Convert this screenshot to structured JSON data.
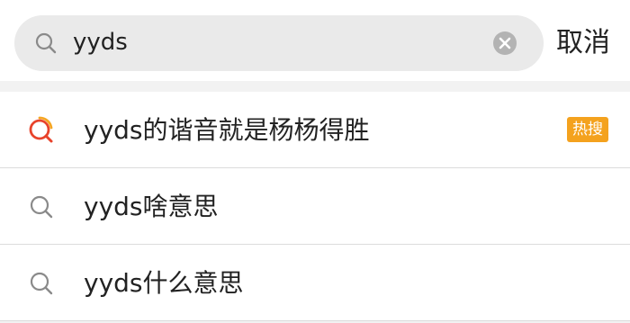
{
  "search": {
    "query": "yyds",
    "cancel_label": "取消"
  },
  "suggestions": [
    {
      "label": "yyds的谐音就是杨杨得胜",
      "icon": "hot-search-icon",
      "badge": "热搜",
      "badge_color": "#f4a21e"
    },
    {
      "label": "yyds啥意思",
      "icon": "search-icon"
    },
    {
      "label": "yyds什么意思",
      "icon": "search-icon"
    }
  ]
}
